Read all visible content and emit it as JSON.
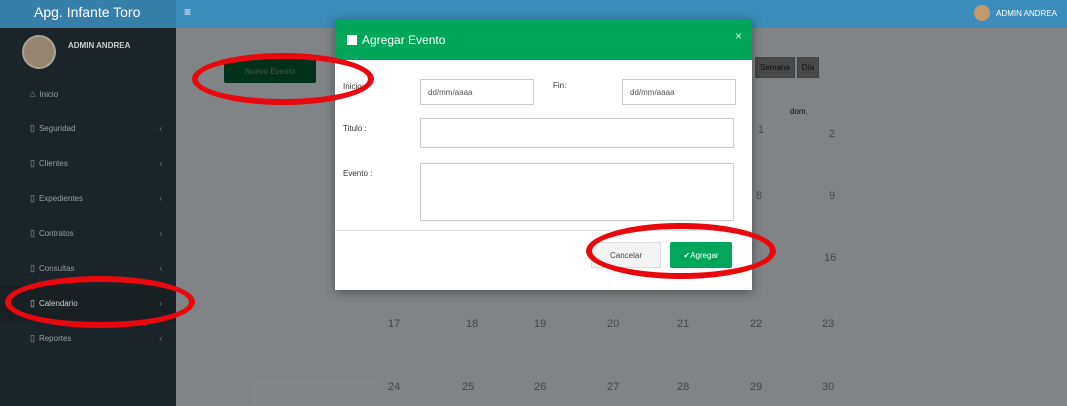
{
  "app": {
    "brand": "Apg. Infante Toro",
    "hamburger_icon": "≡"
  },
  "topbar": {
    "user_name": "ADMIN ANDREA"
  },
  "sidebar": {
    "user_name": "ADMIN ANDREA",
    "items": [
      {
        "label": "Inicio",
        "icon": "home-icon"
      },
      {
        "label": "Seguridad",
        "icon": "folder-icon"
      },
      {
        "label": "Clientes",
        "icon": "folder-icon"
      },
      {
        "label": "Expedientes",
        "icon": "folder-icon"
      },
      {
        "label": "Contratos",
        "icon": "folder-icon"
      },
      {
        "label": "Consultas",
        "icon": "folder-icon"
      },
      {
        "label": "Calendario",
        "icon": "folder-icon"
      },
      {
        "label": "Reportes",
        "icon": "folder-icon"
      }
    ]
  },
  "main": {
    "new_event_label": "Nuevo Evento",
    "calendar": {
      "view_tabs": [
        "Semana",
        "Día"
      ],
      "header_day": "dom.",
      "visible_numbers": [
        "1",
        "2",
        "8",
        "9",
        "16",
        "17",
        "18",
        "19",
        "20",
        "21",
        "22",
        "23",
        "24",
        "25",
        "26",
        "27",
        "28",
        "29",
        "30"
      ]
    }
  },
  "modal": {
    "title": "Agregar Evento",
    "close": "×",
    "inicio_label": "Inicio:",
    "inicio_placeholder": "dd/mm/aaaa",
    "fin_label": "Fin:",
    "fin_placeholder": "dd/mm/aaaa",
    "titulo_label": "Titulo :",
    "evento_label": "Evento :",
    "cancel_label": "Cancelar",
    "add_label": "✔Agregar"
  },
  "colors": {
    "accent": "#00a65a",
    "topbar": "#3c8dbc",
    "sidebar": "#222d32",
    "annotation": "#e8080d"
  }
}
